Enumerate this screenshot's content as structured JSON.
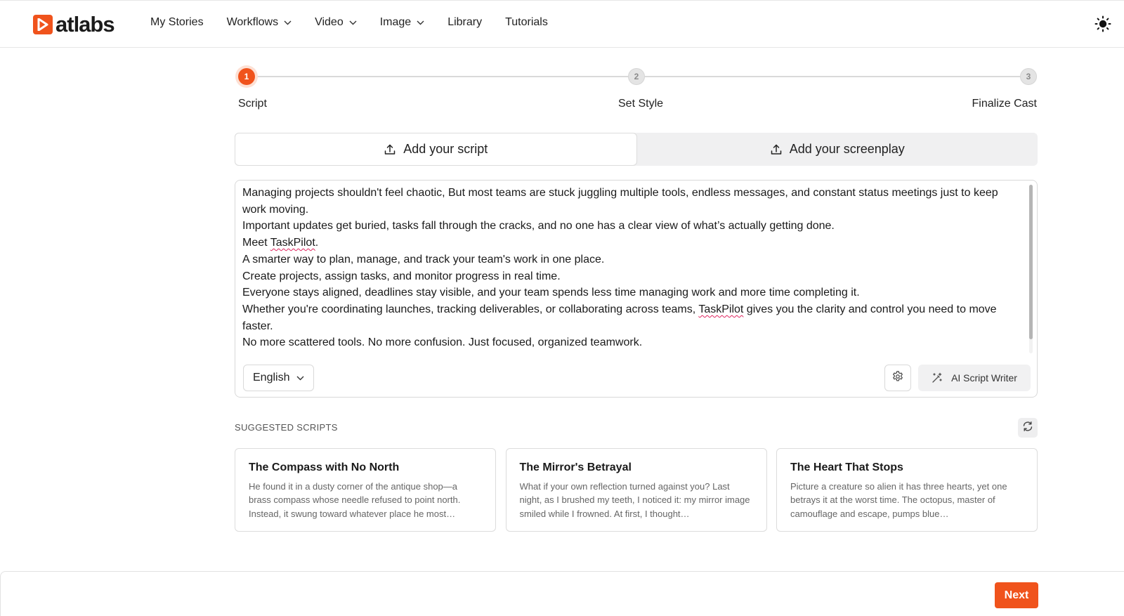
{
  "brand": {
    "name": "atlabs",
    "accent": "#f0531c"
  },
  "nav": {
    "items": [
      {
        "label": "My Stories",
        "has_dropdown": false
      },
      {
        "label": "Workflows",
        "has_dropdown": true
      },
      {
        "label": "Video",
        "has_dropdown": true
      },
      {
        "label": "Image",
        "has_dropdown": true
      },
      {
        "label": "Library",
        "has_dropdown": false
      },
      {
        "label": "Tutorials",
        "has_dropdown": false
      }
    ],
    "theme_icon": "sun-icon"
  },
  "stepper": {
    "current": 1,
    "steps": [
      {
        "number": "1",
        "label": "Script"
      },
      {
        "number": "2",
        "label": "Set Style"
      },
      {
        "number": "3",
        "label": "Finalize Cast"
      }
    ]
  },
  "tabs": {
    "active": 0,
    "items": [
      {
        "label": "Add your script",
        "icon": "upload-icon"
      },
      {
        "label": "Add your screenplay",
        "icon": "upload-icon"
      }
    ]
  },
  "editor": {
    "lines": [
      "Managing projects shouldn't feel chaotic, But most teams are stuck juggling multiple tools, endless messages, and constant status meetings just to keep work moving.",
      "Important updates get buried, tasks fall through the cracks, and no one has a clear view of what’s actually getting done.",
      "Meet TaskPilot.",
      "A smarter way to plan, manage, and track your team's work in one place.",
      "Create projects, assign tasks, and monitor progress in real time.",
      "Everyone stays aligned, deadlines stay visible, and your team spends less time managing work and more time completing it.",
      "Whether you're coordinating launches, tracking deliverables, or collaborating across teams, TaskPilot gives you the clarity and control you need to move faster.",
      "No more scattered tools. No more confusion. Just focused, organized teamwork."
    ],
    "misspelled_word": "TaskPilot",
    "language": "English",
    "settings_icon": "gear-icon",
    "ai_button_label": "AI Script Writer",
    "ai_button_icon": "magic-wand-icon"
  },
  "suggested": {
    "heading": "SUGGESTED SCRIPTS",
    "refresh_icon": "refresh-icon",
    "cards": [
      {
        "title": "The Compass with No North",
        "body": "He found it in a dusty corner of the antique shop—a brass compass whose needle refused to point north. Instead, it swung toward whatever place he most…"
      },
      {
        "title": "The Mirror's Betrayal",
        "body": "What if your own reflection turned against you? Last night, as I brushed my teeth, I noticed it: my mirror image smiled while I frowned. At first, I thought…"
      },
      {
        "title": "The Heart That Stops",
        "body": "Picture a creature so alien it has three hearts, yet one betrays it at the worst time. The octopus, master of camouflage and escape, pumps blue…"
      }
    ]
  },
  "footer": {
    "next_label": "Next"
  }
}
